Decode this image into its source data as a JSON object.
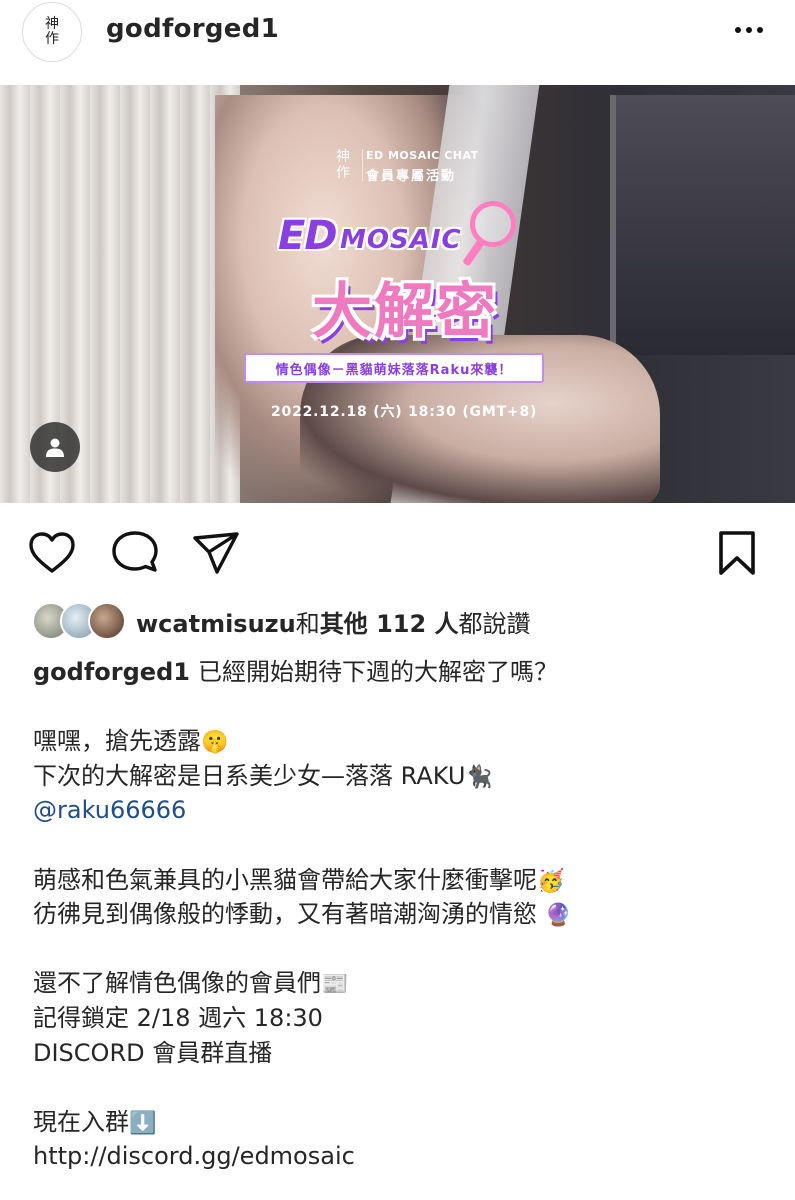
{
  "header": {
    "username": "godforged1",
    "avatar_logo": [
      "神",
      "作"
    ],
    "more_icon": "more-horizontal-icon"
  },
  "post_image": {
    "brand_seal": [
      "神",
      "作"
    ],
    "brand_line1": "ED MOSAIC CHAT",
    "brand_line2": "會員專屬活動",
    "logo_ed": "ED",
    "logo_mosaic": "MOSAIC",
    "logo_big": "大解密",
    "tagline": "情色偶像－黑貓萌妹落落Raku來襲！",
    "event_date": "2022.12.18 (六) 18:30 (GMT+8)",
    "accent_purple": "#8a3fe0",
    "accent_pink": "#f07ac0"
  },
  "actions": {
    "like_icon": "heart-icon",
    "comment_icon": "comment-icon",
    "share_icon": "send-icon",
    "save_icon": "bookmark-icon"
  },
  "likes": {
    "user": "wcatmisuzu",
    "and": "和",
    "others": "其他 112 人",
    "suffix": "都說讚"
  },
  "caption": {
    "user": "godforged1",
    "line1": "已經開始期待下週的大解密了嗎？",
    "line2": "嘿嘿，搶先透露",
    "line2_emoji": "🤫",
    "line3": "下次的大解密是日系美少女—落落 RAKU",
    "line3_emoji": "🐈‍⬛",
    "mention": "@raku66666",
    "line5": "萌感和色氣兼具的小黑貓會帶給大家什麼衝擊呢",
    "line5_emoji": "🥳",
    "line6": "彷彿見到偶像般的悸動，又有著暗潮洶湧的情慾",
    "line6_emoji": "🔮",
    "line7": "還不了解情色偶像的會員們",
    "line7_emoji": "📰",
    "line8": "記得鎖定 2/18 週六 18:30",
    "line9": "DISCORD 會員群直播",
    "line10": "現在入群",
    "line10_emoji": "⬇️",
    "link": "http://discord.gg/edmosaic"
  }
}
